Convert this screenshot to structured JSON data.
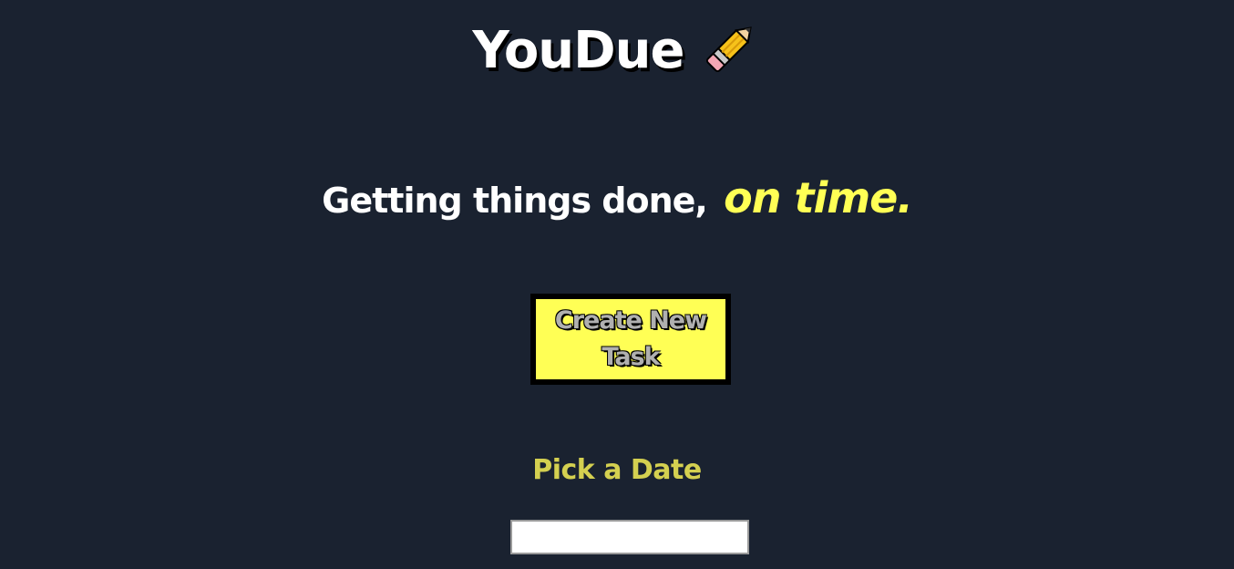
{
  "header": {
    "title": "YouDue",
    "icon": "pencil-icon"
  },
  "tagline": {
    "text": "Getting things done,",
    "emphasis": "on time."
  },
  "actions": {
    "create_label": "Create New Task"
  },
  "date_picker": {
    "label": "Pick a Date",
    "value": ""
  },
  "colors": {
    "background": "#1a2230",
    "accent": "#ffff55",
    "label": "#d4d050",
    "text": "#ffffff"
  }
}
